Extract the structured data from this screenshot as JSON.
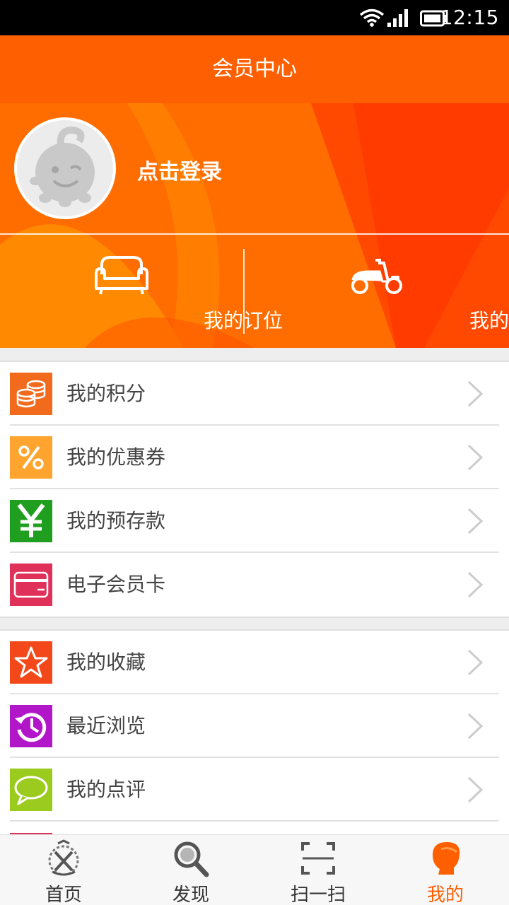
{
  "status_bar": {
    "time": "12:15"
  },
  "header": {
    "title": "会员中心"
  },
  "profile": {
    "login_label": "点击登录",
    "quick_actions": [
      {
        "label": "我的订位",
        "icon": "sofa-icon"
      },
      {
        "label": "我的外卖",
        "icon": "scooter-icon"
      }
    ]
  },
  "menu_group_1": [
    {
      "label": "我的积分",
      "icon": "coins-icon",
      "color": "#f26b1d"
    },
    {
      "label": "我的优惠券",
      "icon": "percent-icon",
      "color": "#ffa52f"
    },
    {
      "label": "我的预存款",
      "icon": "yen-icon",
      "color": "#1f9e1f"
    },
    {
      "label": "电子会员卡",
      "icon": "card-icon",
      "color": "#e0315a"
    }
  ],
  "menu_group_2": [
    {
      "label": "我的收藏",
      "icon": "star-icon",
      "color": "#f2481a"
    },
    {
      "label": "最近浏览",
      "icon": "history-icon",
      "color": "#b117c8"
    },
    {
      "label": "我的点评",
      "icon": "comment-icon",
      "color": "#9bcb1f"
    }
  ],
  "tab_bar": {
    "tabs": [
      {
        "label": "首页",
        "icon": "home-emblem-icon"
      },
      {
        "label": "发现",
        "icon": "search-icon"
      },
      {
        "label": "扫一扫",
        "icon": "scan-icon"
      },
      {
        "label": "我的",
        "icon": "profile-icon"
      }
    ],
    "active_index": 3,
    "active_color": "#fe5f00"
  }
}
